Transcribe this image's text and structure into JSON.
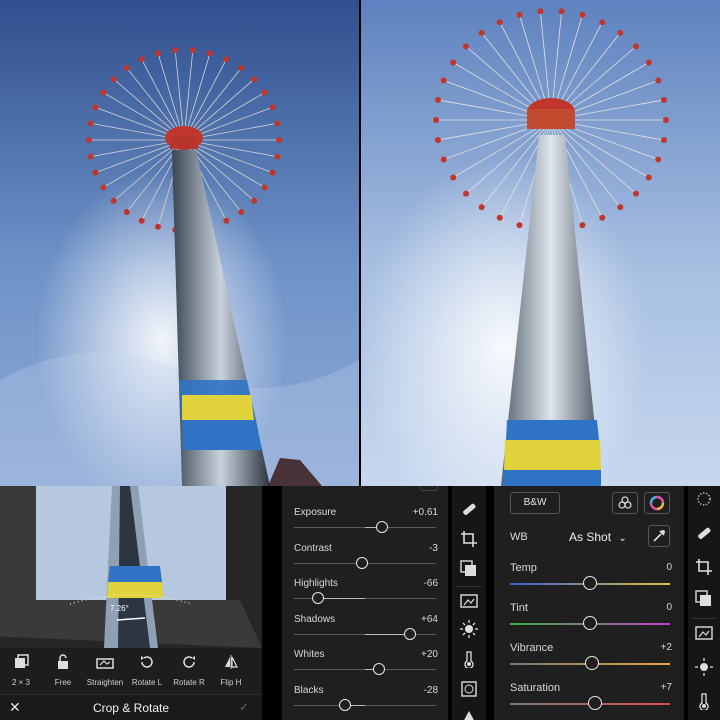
{
  "crop": {
    "angle": "7.26°",
    "title": "Crop & Rotate",
    "tools": [
      {
        "label": "2 × 3",
        "icon": "aspect-ratio-icon"
      },
      {
        "label": "Free",
        "icon": "unlock-icon"
      },
      {
        "label": "Straighten",
        "icon": "straighten-icon"
      },
      {
        "label": "Rotate L",
        "icon": "rotate-left-icon"
      },
      {
        "label": "Rotate R",
        "icon": "rotate-right-icon"
      },
      {
        "label": "Flip H",
        "icon": "flip-horizontal-icon"
      }
    ]
  },
  "light": {
    "sliders": [
      {
        "label": "Exposure",
        "value": "+0.61",
        "level": 0.62
      },
      {
        "label": "Contrast",
        "value": "-3",
        "level": 0.48
      },
      {
        "label": "Highlights",
        "value": "-66",
        "level": 0.17
      },
      {
        "label": "Shadows",
        "value": "+64",
        "level": 0.82
      },
      {
        "label": "Whites",
        "value": "+20",
        "level": 0.6
      },
      {
        "label": "Blacks",
        "value": "-28",
        "level": 0.36
      }
    ]
  },
  "color": {
    "bw_label": "B&W",
    "wb_label": "WB",
    "wb_value": "As Shot",
    "sliders": [
      {
        "label": "Temp",
        "value": "0",
        "level": 0.5,
        "gradient": [
          "#3b5bd6",
          "#e3c23a"
        ]
      },
      {
        "label": "Tint",
        "value": "0",
        "level": 0.5,
        "gradient": [
          "#3fae46",
          "#c23fc7"
        ]
      },
      {
        "label": "Vibrance",
        "value": "+2",
        "level": 0.51,
        "gradient": [
          "#777777",
          "#e8a73b"
        ]
      },
      {
        "label": "Saturation",
        "value": "+7",
        "level": 0.53,
        "gradient": [
          "#777777",
          "#e04b4b"
        ]
      }
    ]
  },
  "colors": {
    "sky_top": "#3a5fa3",
    "sky_bottom": "#a9c4e6",
    "tower_red": "#c0362c",
    "tower_yellow": "#e0d23a",
    "tower_blue": "#2f74c4",
    "panel_bg": "#1f1f1f"
  }
}
